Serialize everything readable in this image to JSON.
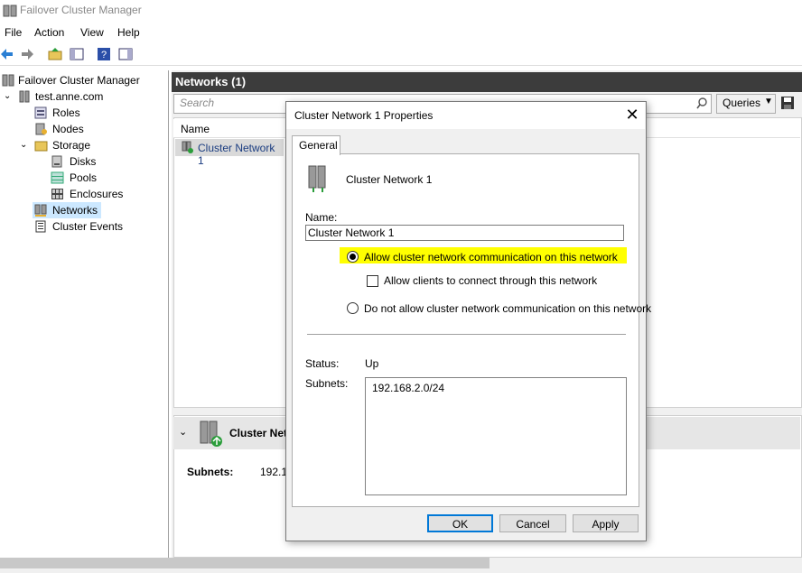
{
  "window": {
    "title": "Failover Cluster Manager"
  },
  "menu": [
    "File",
    "Action",
    "View",
    "Help"
  ],
  "tree": {
    "root": "Failover Cluster Manager",
    "cluster": "test.anne.com",
    "roles": "Roles",
    "nodes": "Nodes",
    "storage": "Storage",
    "disks": "Disks",
    "pools": "Pools",
    "enclosures": "Enclosures",
    "networks": "Networks",
    "cluster_events": "Cluster Events"
  },
  "main": {
    "header": "Networks (1)",
    "search_placeholder": "Search",
    "queries_label": "Queries",
    "column_name": "Name",
    "row_name": "Cluster Network 1",
    "detail_title": "Cluster Net",
    "detail_subnets_label": "Subnets:",
    "detail_subnets_value": "192.1("
  },
  "dialog": {
    "title": "Cluster Network 1 Properties",
    "close_glyph": "✕",
    "tab_general": "General",
    "network_name": "Cluster Network 1",
    "name_label": "Name:",
    "name_value": "Cluster Network 1",
    "radio_allow": "Allow cluster network communication on this network",
    "check_allow_clients": "Allow clients to connect through this network",
    "radio_disallow": "Do not allow cluster network communication on this network",
    "status_label": "Status:",
    "status_value": "Up",
    "subnets_label": "Subnets:",
    "subnets_value": "192.168.2.0/24",
    "ok": "OK",
    "cancel": "Cancel",
    "apply": "Apply"
  },
  "colors": {
    "highlight": "#ffff00",
    "header_bg": "#3c3c3c",
    "selection": "#cce8ff"
  }
}
